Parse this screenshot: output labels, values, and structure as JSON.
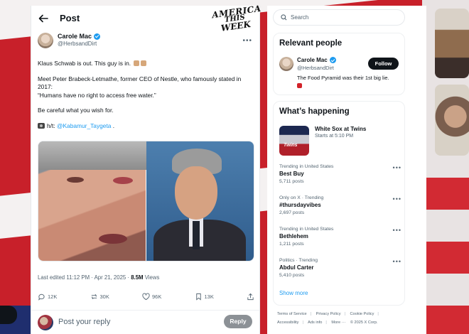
{
  "tweet": {
    "header_title": "Post",
    "overlay_logo": {
      "line1": "AMERICA",
      "line2": "THIS",
      "line3": "WEEK"
    },
    "author": {
      "name": "Carole Mac",
      "handle": "@HerbsandDirt"
    },
    "body": {
      "line1": "Klaus Schwab is out. This guy is in.",
      "line2": "Meet Peter Brabeck-Letmathe, former CEO of Nestle, who famously stated in 2017:",
      "quote": "“Humans have no right to access free water.”",
      "line3": "Be careful what you wish for.",
      "ht_prefix": "h/t:",
      "ht_link": "@Kabamur_Taygeta",
      "ht_suffix": "."
    },
    "meta": {
      "edited": "Last edited 11:12 PM · Apr 21, 2025 ·",
      "views_count": "8.5M",
      "views_label": "Views"
    },
    "actions": {
      "replies": "12K",
      "reposts": "30K",
      "likes": "96K",
      "bookmarks": "13K"
    },
    "reply": {
      "placeholder": "Post your reply",
      "button": "Reply"
    }
  },
  "search": {
    "placeholder": "Search"
  },
  "relevant_people": {
    "title": "Relevant people",
    "person": {
      "name": "Carole Mac",
      "handle": "@HerbsandDirt",
      "bio": "The Food Pyramid was their 1st big lie.",
      "follow_label": "Follow"
    }
  },
  "whats_happening": {
    "title": "What’s happening",
    "event": {
      "title": "White Sox at Twins",
      "subtitle": "Starts at 5:10 PM"
    },
    "trends": [
      {
        "context": "Trending in United States",
        "topic": "Best Buy",
        "posts": "5,711 posts"
      },
      {
        "context": "Only on X · Trending",
        "topic": "#thursdayvibes",
        "posts": "2,697 posts"
      },
      {
        "context": "Trending in United States",
        "topic": "Bethlehem",
        "posts": "1,211 posts"
      },
      {
        "context": "Politics · Trending",
        "topic": "Abdul Carter",
        "posts": "5,410 posts"
      }
    ],
    "show_more": "Show more"
  },
  "footer": {
    "links": [
      "Terms of Service",
      "Privacy Policy",
      "Cookie Policy",
      "Accessibility",
      "Ads info",
      "More ···"
    ],
    "copyright": "© 2025 X Corp."
  },
  "colors": {
    "accent": "#1d9bf0",
    "text": "#0f1419",
    "muted": "#536471"
  }
}
